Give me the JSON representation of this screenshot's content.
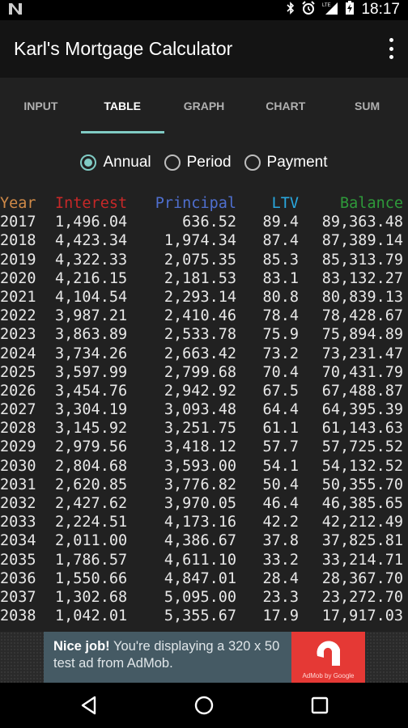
{
  "status_bar": {
    "left_icon": "n-notification-icon",
    "icons": [
      "bluetooth-icon",
      "alarm-icon",
      "lte-signal-icon",
      "battery-charging-icon"
    ],
    "lte_label": "LTE",
    "time": "18:17"
  },
  "app_bar": {
    "title": "Karl's Mortgage Calculator",
    "overflow_icon": "more-vert-icon"
  },
  "tabs": [
    {
      "label": "INPUT",
      "active": false
    },
    {
      "label": "TABLE",
      "active": true
    },
    {
      "label": "GRAPH",
      "active": false
    },
    {
      "label": "CHART",
      "active": false
    },
    {
      "label": "SUM",
      "active": false
    }
  ],
  "view_mode": {
    "options": [
      {
        "label": "Annual",
        "selected": true
      },
      {
        "label": "Period",
        "selected": false
      },
      {
        "label": "Payment",
        "selected": false
      }
    ]
  },
  "accent_color": "#80cbc4",
  "table": {
    "headers": [
      "Year",
      "Interest",
      "Principal",
      "LTV",
      "Balance"
    ],
    "header_colors": [
      "#d08a48",
      "#c62828",
      "#4f6fcf",
      "#29a8df",
      "#2e9a3a"
    ],
    "rows": [
      [
        "2017",
        "1,496.04",
        "636.52",
        "89.4",
        "89,363.48"
      ],
      [
        "2018",
        "4,423.34",
        "1,974.34",
        "87.4",
        "87,389.14"
      ],
      [
        "2019",
        "4,322.33",
        "2,075.35",
        "85.3",
        "85,313.79"
      ],
      [
        "2020",
        "4,216.15",
        "2,181.53",
        "83.1",
        "83,132.27"
      ],
      [
        "2021",
        "4,104.54",
        "2,293.14",
        "80.8",
        "80,839.13"
      ],
      [
        "2022",
        "3,987.21",
        "2,410.46",
        "78.4",
        "78,428.67"
      ],
      [
        "2023",
        "3,863.89",
        "2,533.78",
        "75.9",
        "75,894.89"
      ],
      [
        "2024",
        "3,734.26",
        "2,663.42",
        "73.2",
        "73,231.47"
      ],
      [
        "2025",
        "3,597.99",
        "2,799.68",
        "70.4",
        "70,431.79"
      ],
      [
        "2026",
        "3,454.76",
        "2,942.92",
        "67.5",
        "67,488.87"
      ],
      [
        "2027",
        "3,304.19",
        "3,093.48",
        "64.4",
        "64,395.39"
      ],
      [
        "2028",
        "3,145.92",
        "3,251.75",
        "61.1",
        "61,143.63"
      ],
      [
        "2029",
        "2,979.56",
        "3,418.12",
        "57.7",
        "57,725.52"
      ],
      [
        "2030",
        "2,804.68",
        "3,593.00",
        "54.1",
        "54,132.52"
      ],
      [
        "2031",
        "2,620.85",
        "3,776.82",
        "50.4",
        "50,355.70"
      ],
      [
        "2032",
        "2,427.62",
        "3,970.05",
        "46.4",
        "46,385.65"
      ],
      [
        "2033",
        "2,224.51",
        "4,173.16",
        "42.2",
        "42,212.49"
      ],
      [
        "2034",
        "2,011.00",
        "4,386.67",
        "37.8",
        "37,825.81"
      ],
      [
        "2035",
        "1,786.57",
        "4,611.10",
        "33.2",
        "33,214.71"
      ],
      [
        "2036",
        "1,550.66",
        "4,847.01",
        "28.4",
        "28,367.70"
      ],
      [
        "2037",
        "1,302.68",
        "5,095.00",
        "23.3",
        "23,272.70"
      ],
      [
        "2038",
        "1,042.01",
        "5,355.67",
        "17.9",
        "17,917.03"
      ]
    ]
  },
  "ad": {
    "bold_text": "Nice job!",
    "text": " You're displaying a 320 x 50 test ad from AdMob.",
    "logo_text": "AdMob by Google",
    "logo_color": "#e53935"
  },
  "nav_bar": {
    "buttons": [
      "back-icon",
      "home-icon",
      "recents-icon"
    ]
  }
}
